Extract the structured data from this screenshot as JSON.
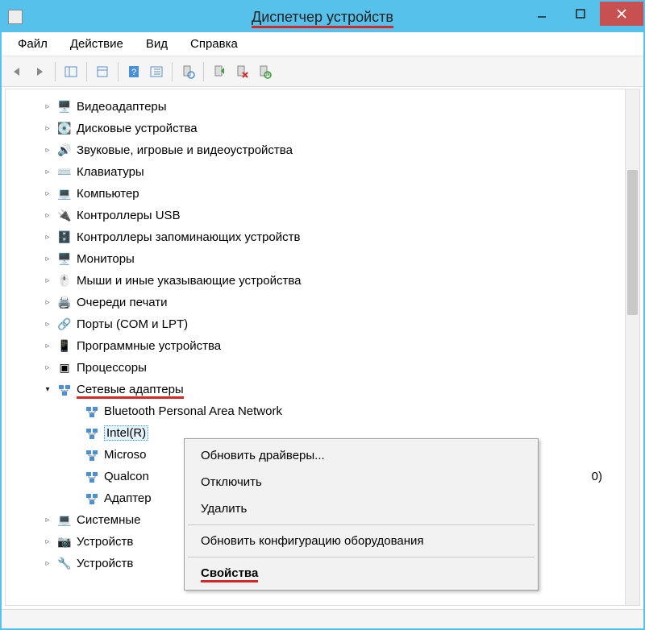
{
  "window": {
    "title": "Диспетчер устройств"
  },
  "menu": {
    "file": "Файл",
    "action": "Действие",
    "view": "Вид",
    "help": "Справка"
  },
  "tree": {
    "items": [
      {
        "label": "Видеоадаптеры",
        "icon": "🖥️"
      },
      {
        "label": "Дисковые устройства",
        "icon": "💽"
      },
      {
        "label": "Звуковые, игровые и видеоустройства",
        "icon": "🔊"
      },
      {
        "label": "Клавиатуры",
        "icon": "⌨️"
      },
      {
        "label": "Компьютер",
        "icon": "💻"
      },
      {
        "label": "Контроллеры USB",
        "icon": "🔌"
      },
      {
        "label": "Контроллеры запоминающих устройств",
        "icon": "🗄️"
      },
      {
        "label": "Мониторы",
        "icon": "🖥️"
      },
      {
        "label": "Мыши и иные указывающие устройства",
        "icon": "🖱️"
      },
      {
        "label": "Очереди печати",
        "icon": "🖨️"
      },
      {
        "label": "Порты (COM и LPT)",
        "icon": "🔗"
      },
      {
        "label": "Программные устройства",
        "icon": "📱"
      },
      {
        "label": "Процессоры",
        "icon": "▣"
      }
    ],
    "network": {
      "label": "Сетевые адаптеры",
      "children": [
        "Bluetooth Personal Area Network",
        "Intel(R)",
        "Microso",
        "Qualcon",
        "Адаптер"
      ],
      "truncated_tail": "0)"
    },
    "after": [
      {
        "label": "Системные",
        "icon": "💻"
      },
      {
        "label": "Устройств",
        "icon": "📷"
      },
      {
        "label": "Устройств",
        "icon": "🔧"
      }
    ]
  },
  "context": {
    "update": "Обновить драйверы...",
    "disable": "Отключить",
    "delete": "Удалить",
    "scan": "Обновить конфигурацию оборудования",
    "properties": "Свойства"
  }
}
